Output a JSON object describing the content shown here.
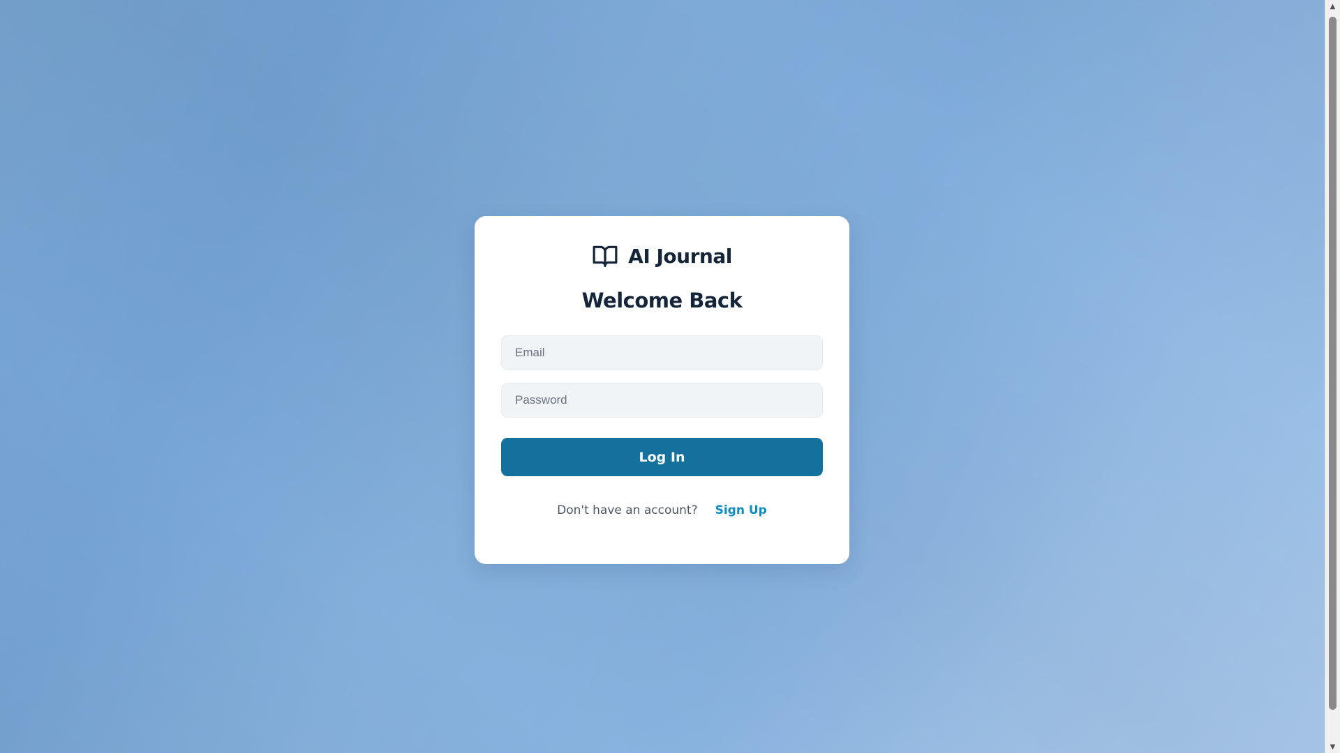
{
  "app": {
    "name": "AI Journal",
    "icon": "open-book-icon"
  },
  "login": {
    "heading": "Welcome Back",
    "email_placeholder": "Email",
    "email_value": "",
    "password_placeholder": "Password",
    "password_value": "",
    "submit_label": "Log In",
    "signup_prompt": "Don't have an account?",
    "signup_link": "Sign Up"
  },
  "colors": {
    "primary_button": "#14719e",
    "link": "#0a8cc4",
    "heading_text": "#14253a",
    "background_start": "#6d9ccc",
    "background_end": "#a9c8ea"
  }
}
